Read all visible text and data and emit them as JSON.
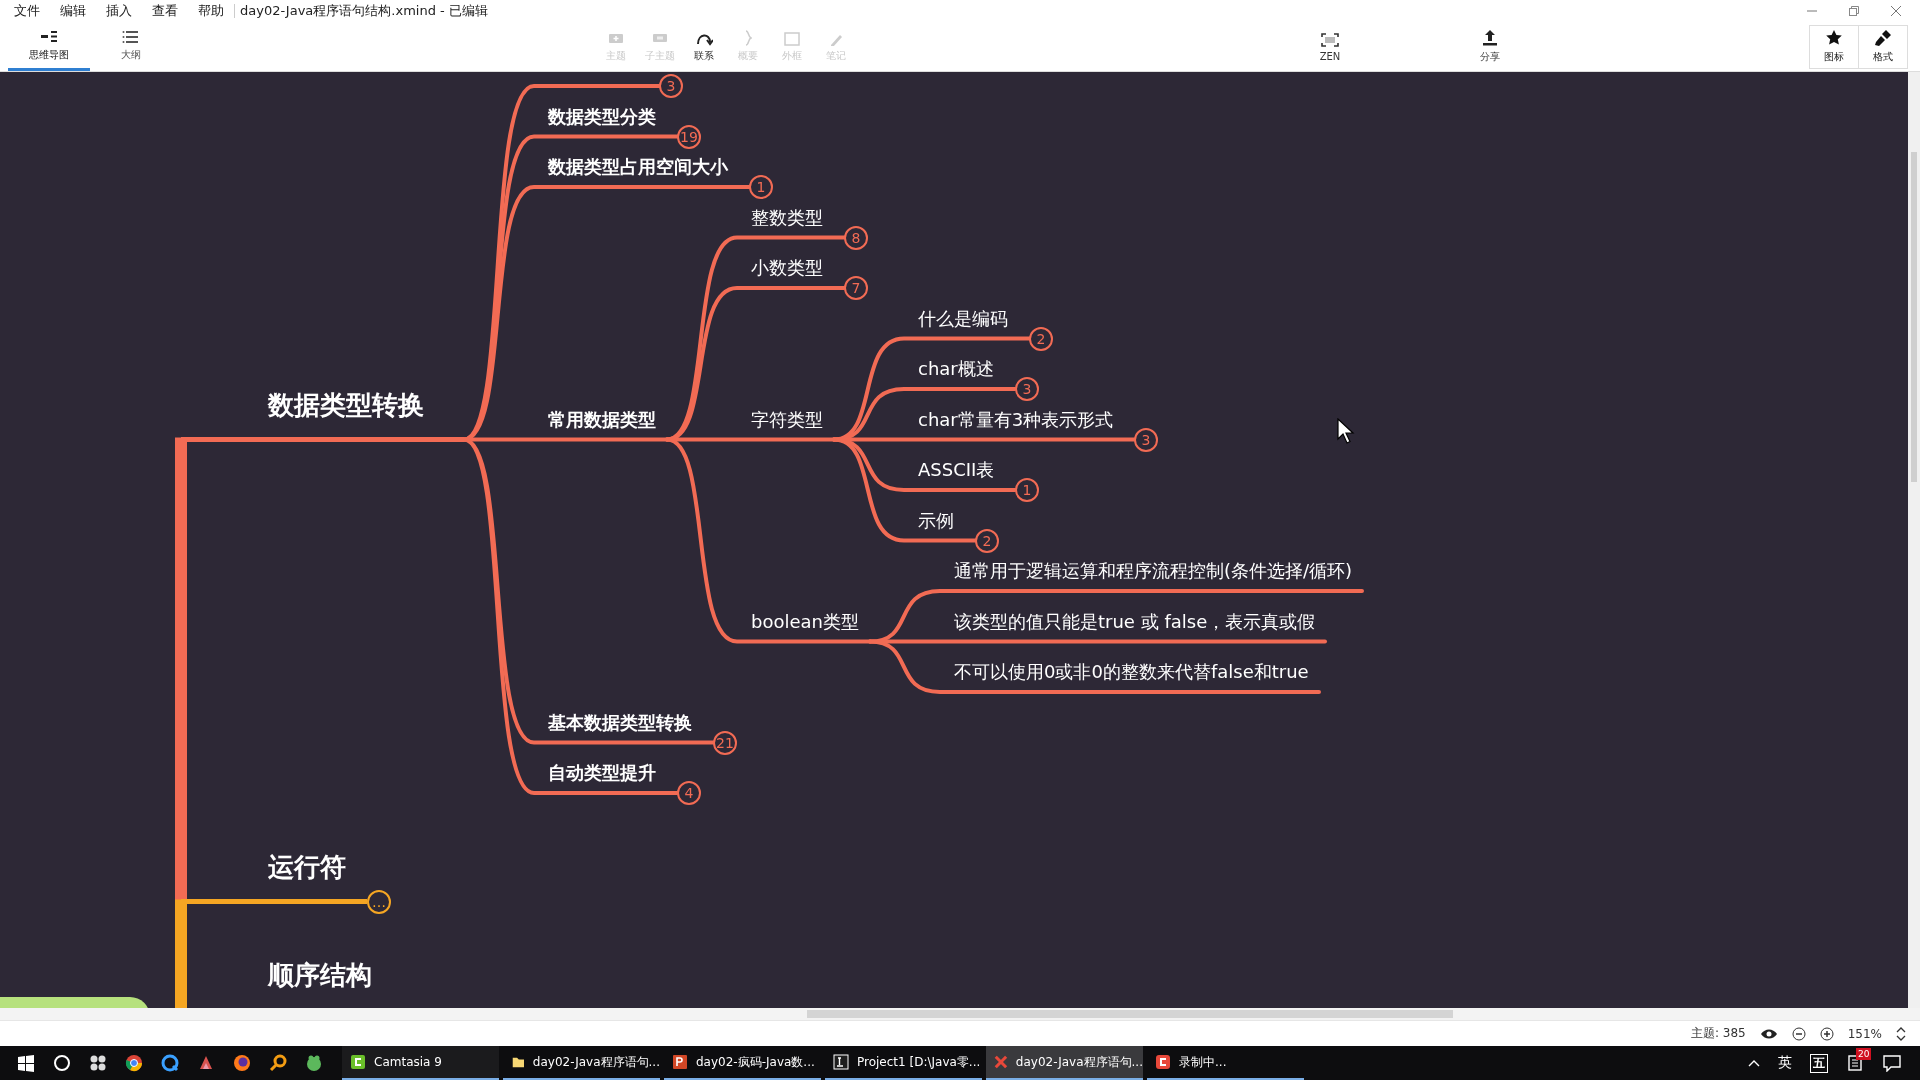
{
  "window": {
    "title": "day02-Java程序语句结构.xmind - 已编辑"
  },
  "menu": [
    "文件",
    "编辑",
    "插入",
    "查看",
    "帮助"
  ],
  "view_tabs": [
    {
      "label": "思维导图",
      "kind": "mindmap",
      "selected": true
    },
    {
      "label": "大纲",
      "kind": "outline",
      "selected": false
    }
  ],
  "tools": [
    {
      "label": "主题",
      "kind": "topic",
      "disabled": true
    },
    {
      "label": "子主题",
      "kind": "subtopic",
      "disabled": true
    },
    {
      "label": "联系",
      "kind": "relation",
      "disabled": false
    },
    {
      "label": "概要",
      "kind": "summary",
      "disabled": true
    },
    {
      "label": "外框",
      "kind": "boundary",
      "disabled": true
    },
    {
      "label": "笔记",
      "kind": "note",
      "disabled": true
    }
  ],
  "zen": {
    "label": "ZEN"
  },
  "share": {
    "label": "分享"
  },
  "panel_buttons": [
    {
      "label": "图标",
      "kind": "icons"
    },
    {
      "label": "格式",
      "kind": "format"
    }
  ],
  "mindmap": {
    "topics": [
      {
        "label": "数据类型转换",
        "color": "#f26b54",
        "children": [
          {
            "collapsed_count": "3"
          },
          {
            "label": "数据类型分类",
            "collapsed_count": "19"
          },
          {
            "label": "数据类型占用空间大小",
            "collapsed_count": "1"
          },
          {
            "label": "常用数据类型",
            "children": [
              {
                "label": "整数类型",
                "collapsed_count": "8"
              },
              {
                "label": "小数类型",
                "collapsed_count": "7"
              },
              {
                "label": "字符类型",
                "children": [
                  {
                    "label": "什么是编码",
                    "collapsed_count": "2"
                  },
                  {
                    "label": "char概述",
                    "collapsed_count": "3"
                  },
                  {
                    "label": "char常量有3种表示形式",
                    "collapsed_count": "3"
                  },
                  {
                    "label": "ASSCII表",
                    "collapsed_count": "1"
                  },
                  {
                    "label": "示例",
                    "collapsed_count": "2"
                  }
                ]
              },
              {
                "label": "boolean类型",
                "children": [
                  {
                    "label": "通常用于逻辑运算和程序流程控制(条件选择/循环)"
                  },
                  {
                    "label": "该类型的值只能是true 或 false，表示真或假"
                  },
                  {
                    "label": "不可以使用0或非0的整数来代替false和true"
                  }
                ]
              }
            ]
          },
          {
            "label": "基本数据类型转换",
            "collapsed_count": "21"
          },
          {
            "label": "自动类型提升",
            "collapsed_count": "4"
          }
        ]
      },
      {
        "label": "运行符",
        "color": "#f5a623",
        "collapsed_count": "…"
      },
      {
        "label": "顺序结构"
      }
    ]
  },
  "status_bar": {
    "topic_count": "主题: 385",
    "zoom": "151%"
  },
  "taskbar": {
    "apps": [
      {
        "label": "Camtasia 9",
        "kind": "camtasia",
        "active": false
      },
      {
        "label": "day02-Java程序语句...",
        "kind": "folder",
        "active": false
      },
      {
        "label": "day02-疯码-Java数...",
        "kind": "slides",
        "active": false
      },
      {
        "label": "Project1 [D:\\Java零...",
        "kind": "ide",
        "active": false
      },
      {
        "label": "day02-Java程序语句...",
        "kind": "xmind",
        "active": true
      },
      {
        "label": "录制中...",
        "kind": "recorder",
        "active": false
      }
    ],
    "ime_lang": "英",
    "ime_mode": "五",
    "notifications": "20"
  }
}
